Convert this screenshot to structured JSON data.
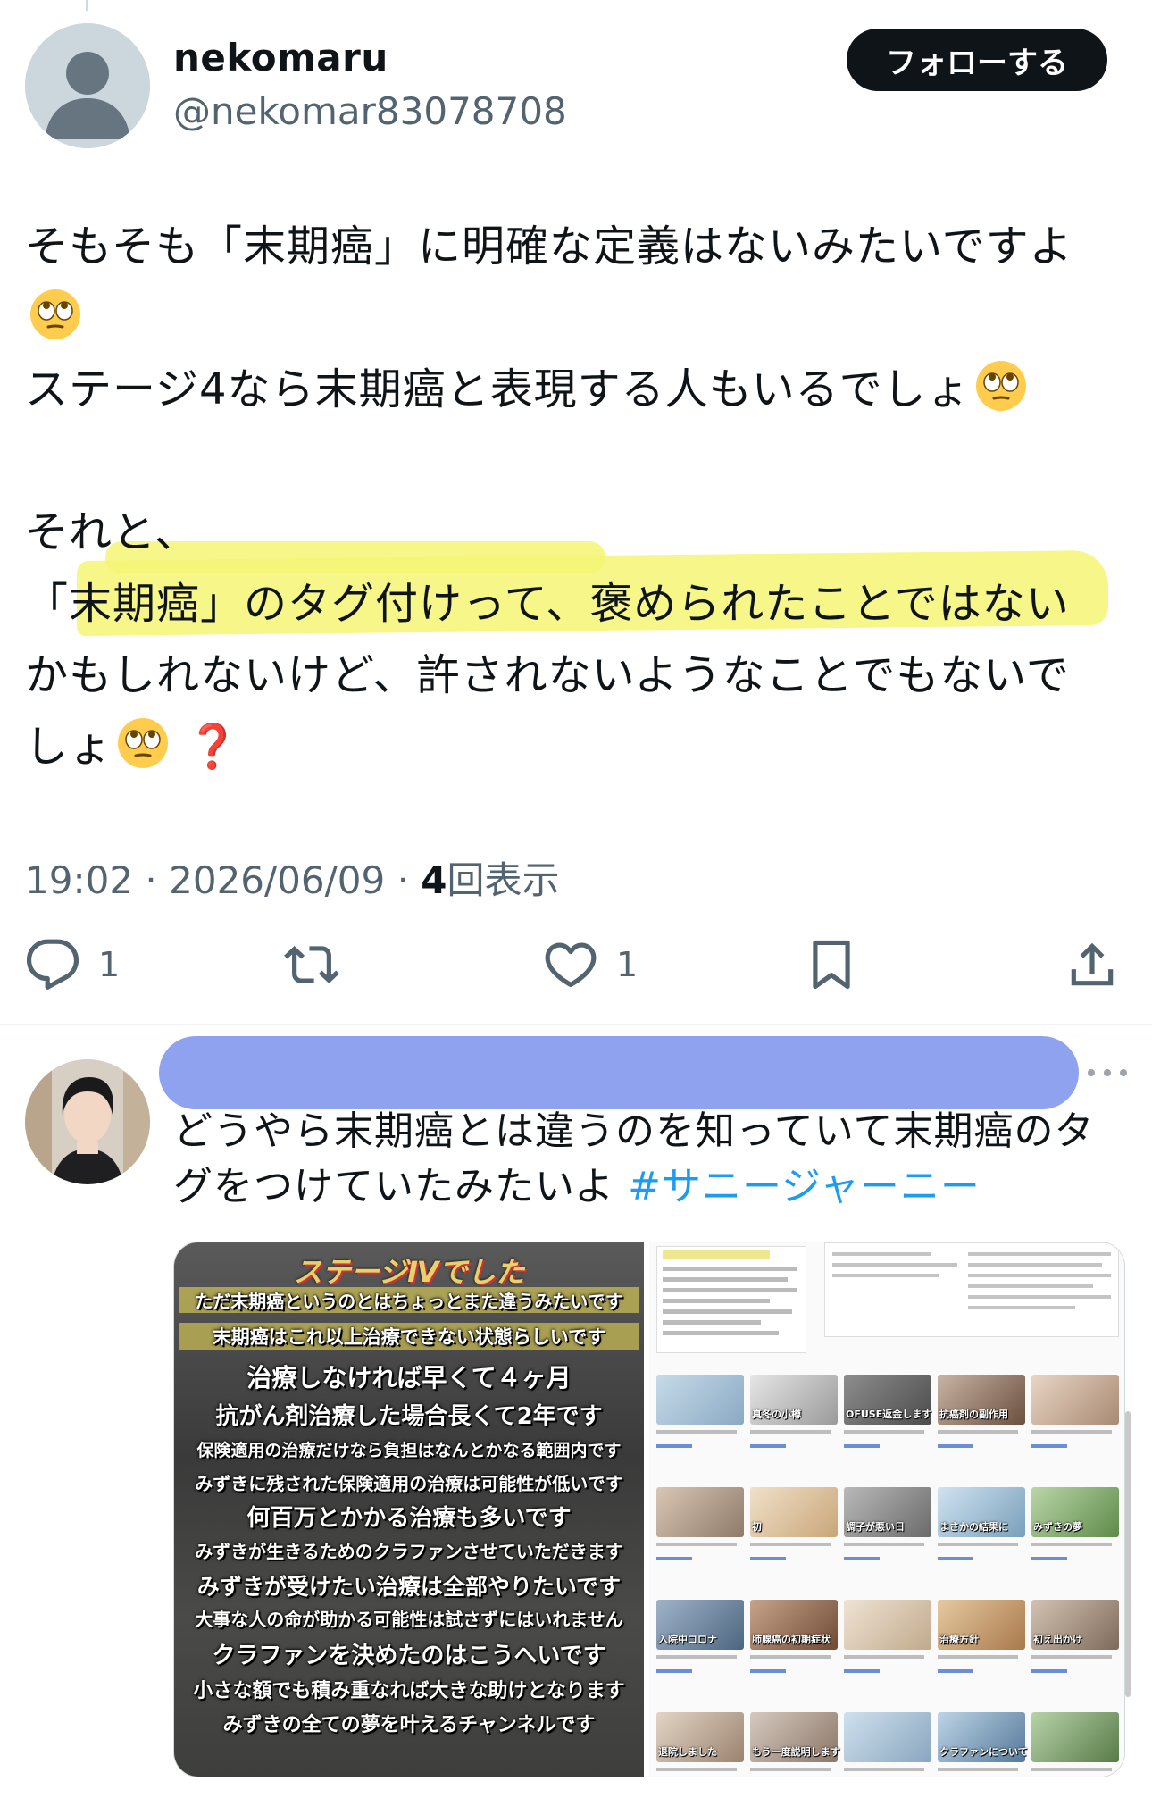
{
  "post": {
    "display_name": "nekomaru",
    "handle": "@nekomar83078708",
    "follow_label": "フォローする",
    "lines": [
      "そもそも「末期癌」に明確な定義はないみたいですよ",
      "",
      "ステージ4なら末期癌と表現する人もいるでしょ",
      "",
      "それと、",
      "「末期癌」のタグ付けって、褒められたことではない",
      "かもしれないけど、許されないようなことでもないで",
      "しょ"
    ],
    "question_mark": "❓",
    "time": "19:02",
    "date": "2026/06/09",
    "views_count": "4",
    "views_label": "回表示",
    "sep": "·",
    "reply_count": "1",
    "like_count": "1"
  },
  "reply": {
    "line1": "どうやら末期癌とは違うのを知っていて末期癌のタ",
    "line2_text": "グをつけていたみたいよ ",
    "hashtag": "#サニージャーニー",
    "more_icon": "ellipsis-icon"
  },
  "media": {
    "left_captions": [
      "ステージⅣでした",
      "ただ末期癌というのとはちょっとまた違うみたいです",
      "末期癌はこれ以上治療できない状態らしいです",
      "治療しなければ早くて４ヶ月",
      "抗がん剤治療した場合長くて2年です",
      "保険適用の治療だけなら負担はなんとかなる範囲内です",
      "みずきに残された保険適用の治療は可能性が低いです",
      "何百万とかかる治療も多いです",
      "みずきが生きるためのクラファンさせていただきます",
      "みずきが受けたい治療は全部やりたいです",
      "大事な人の命が助かる可能性は試さずにはいれません",
      "クラファンを決めたのはこうへいです",
      "小さな額でも積み重なれば大きな助けとなります",
      "みずきの全ての夢を叶えるチャンネルです"
    ],
    "thumb_labels": [
      "",
      "真冬の小樽",
      "OFUSE返金します",
      "抗癌剤の副作用",
      "",
      "",
      "初",
      "調子が悪い日",
      "まさかの結果に",
      "みずきの夢",
      "入院中コロナ",
      "肺腺癌の初期症状",
      "",
      "治療方針",
      "初え出かけ",
      "退院しました",
      "もう一度説明します",
      "",
      "クラファンについて",
      ""
    ]
  },
  "colors": {
    "highlight": "#f5f574",
    "redaction": "#8fa2f0",
    "link": "#1d9bf0",
    "follow_bg": "#0f1419"
  }
}
